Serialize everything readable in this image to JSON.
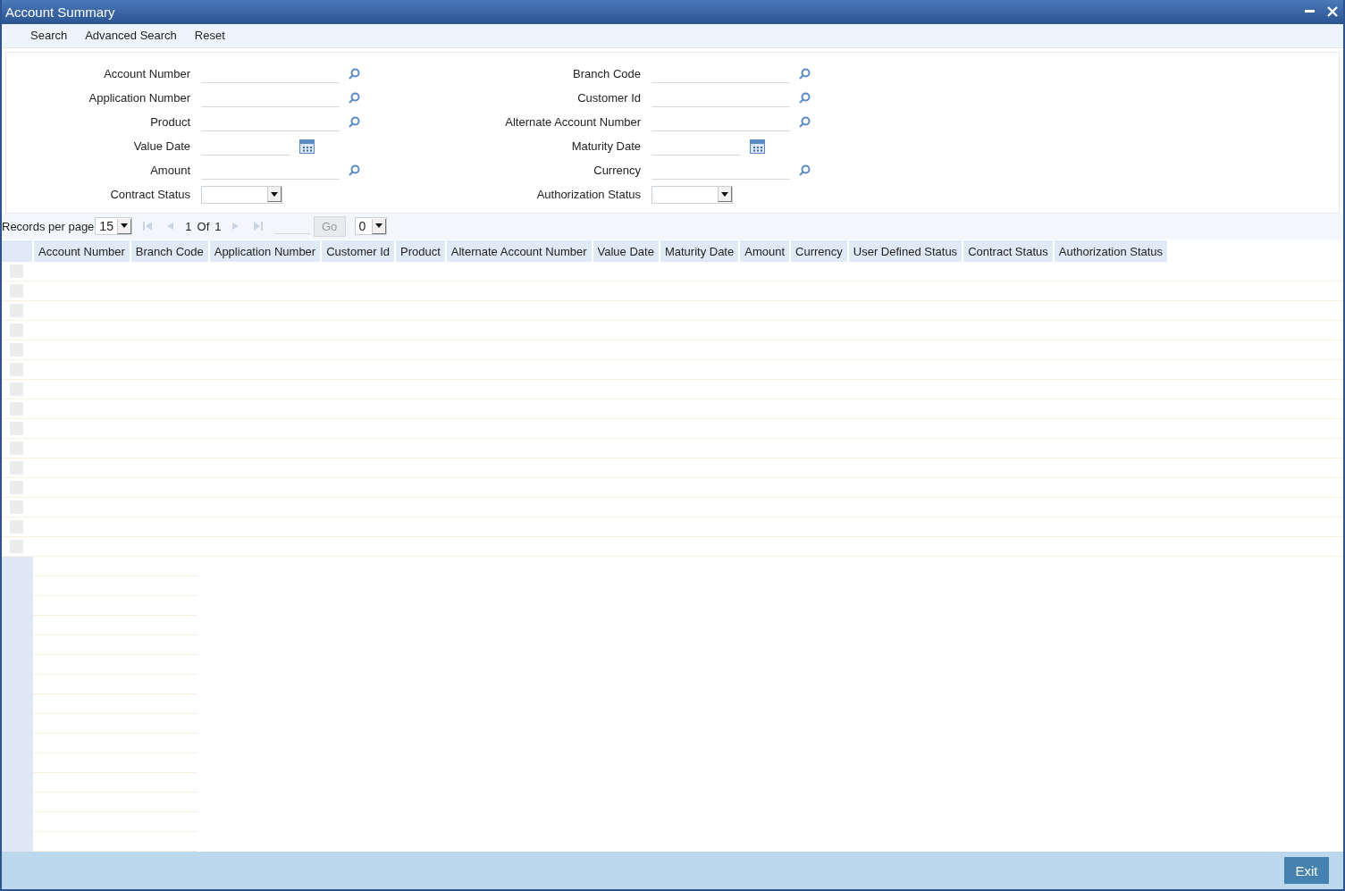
{
  "window": {
    "title": "Account Summary"
  },
  "toolbar": [
    "Search",
    "Advanced Search",
    "Reset"
  ],
  "form": {
    "columns": [
      [
        {
          "label": "Account Number",
          "kind": "lookup"
        },
        {
          "label": "Application Number",
          "kind": "lookup"
        },
        {
          "label": "Product",
          "kind": "lookup"
        },
        {
          "label": "Value Date",
          "kind": "date"
        },
        {
          "label": "Amount",
          "kind": "lookup"
        },
        {
          "label": "Contract Status",
          "kind": "select"
        }
      ],
      [
        {
          "label": "Branch Code",
          "kind": "lookup"
        },
        {
          "label": "Customer Id",
          "kind": "lookup"
        },
        {
          "label": "Alternate Account Number",
          "kind": "lookup"
        },
        {
          "label": "Maturity Date",
          "kind": "date"
        },
        {
          "label": "Currency",
          "kind": "lookup"
        },
        {
          "label": "Authorization Status",
          "kind": "select"
        }
      ]
    ]
  },
  "pager": {
    "records_label": "Records per page",
    "records_value": "15",
    "page": "1",
    "of_label": "Of",
    "total": "1",
    "go": "Go",
    "page_select": "0"
  },
  "table": {
    "columns": [
      "Account Number",
      "Branch Code",
      "Application Number",
      "Customer Id",
      "Product",
      "Alternate Account Number",
      "Value Date",
      "Maturity Date",
      "Amount",
      "Currency",
      "User Defined Status",
      "Contract Status",
      "Authorization Status"
    ],
    "rows": [
      {
        "checked": false
      },
      {
        "checked": false
      },
      {
        "checked": false
      },
      {
        "checked": false
      },
      {
        "checked": false
      },
      {
        "checked": false
      },
      {
        "checked": false
      },
      {
        "checked": false
      },
      {
        "checked": false
      },
      {
        "checked": false
      },
      {
        "checked": false
      },
      {
        "checked": false
      },
      {
        "checked": false
      },
      {
        "checked": false
      },
      {
        "checked": false
      }
    ]
  },
  "footer": {
    "exit": "Exit"
  }
}
